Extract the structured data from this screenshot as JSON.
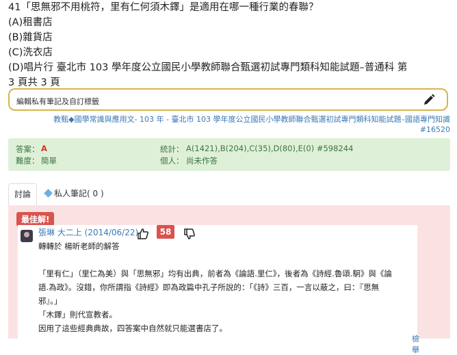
{
  "question": {
    "stem": "41「思無邪不用桃符，里有仁何須木鐸」是適用在哪一種行業的春聯？",
    "options": [
      "(A)租書店",
      "(B)雜貨店",
      "(C)洗衣店",
      "(D)唱片行 臺北市 103 學年度公立國民小學教師聯合甄選初試專門類科知能試題–普通科 第"
    ],
    "page_line": "3 頁共 3 頁"
  },
  "note": {
    "label": "編輯私有筆記及自訂標籤",
    "icon": "pencil-icon"
  },
  "tags": {
    "line1": "教甄◆國學常識與應用文- 103 年 - 臺北市 103 學年度公立國民小學教師聯合甄選初試專門類科知能試題–國語專門知識",
    "line2": "#16520"
  },
  "stats": {
    "answer_label": "答案：",
    "answer_value": "A",
    "difficulty_label": "難度：",
    "difficulty_value": "簡單",
    "stat_label": "統計：",
    "stat_value": "A(1421),B(204),C(35),D(80),E(0) #598244",
    "personal_label": "個人：",
    "personal_value": "尚未作答",
    "colors": {
      "bg": "#dff0d8",
      "text": "#3c763d",
      "answer": "#d9332a"
    }
  },
  "tabs": [
    {
      "label": "討論",
      "active": true
    },
    {
      "label": "私人筆記( 0 )",
      "active": false,
      "icon": "diamond-icon"
    }
  ],
  "discussion": {
    "best_badge": "最佳解!",
    "user": "張琳 大二上 (2014/06/22)",
    "score": "58",
    "lines": [
      "轉轉於 楊昕老師的解答",
      "",
      "「里有仁」（里仁為美）與「思無邪」均有出典，前者為《論語.里仁》，後者為《詩經.魯頌.駉》與《論",
      "語.為政》。沒錯，你所謂指《詩經》即為政篇中孔子所說的：「《詩》三百，一言以蔽之，曰：『思無",
      "邪』。」",
      "「木鐸」則代宣教者。",
      "因用了這些經典典故，四答案中自然就只能選書店了。"
    ],
    "more": "檢舉"
  }
}
